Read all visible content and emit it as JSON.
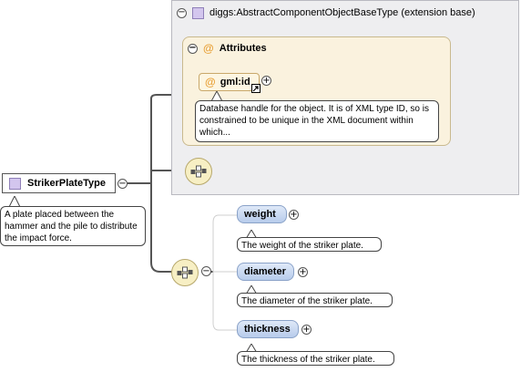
{
  "root": {
    "name": "StrikerPlateType",
    "annotation": "A plate placed between the hammer and the pile to distribute the impact force."
  },
  "base": {
    "label": "diggs:AbstractComponentObjectBaseType (extension base)",
    "attributes_label": "Attributes",
    "attribute": {
      "name": "gml:id",
      "annotation": "Database handle for the object. It is of XML type ID, so is constrained to be unique in the XML document within which..."
    }
  },
  "sequence": {
    "elements": [
      {
        "name": "weight",
        "annotation": "The weight of the striker plate."
      },
      {
        "name": "diameter",
        "annotation": "The diameter of the striker plate."
      },
      {
        "name": "thickness",
        "annotation": "The thickness of the striker plate."
      }
    ]
  },
  "glyphs": {
    "collapse": "−",
    "expand": "+",
    "at": "@"
  },
  "icons": [
    "complex-type-icon",
    "attribute-icon",
    "sequence-compositor-icon",
    "expand-icon",
    "collapse-icon",
    "reference-arrow-icon"
  ],
  "colors": {
    "element_fill": "#b7cbeb",
    "attribute_group_fill": "#faf2de",
    "base_frame_fill": "#eeeef0",
    "type_icon": "#d3c6ee",
    "attribute_marker": "#e8a23a"
  }
}
